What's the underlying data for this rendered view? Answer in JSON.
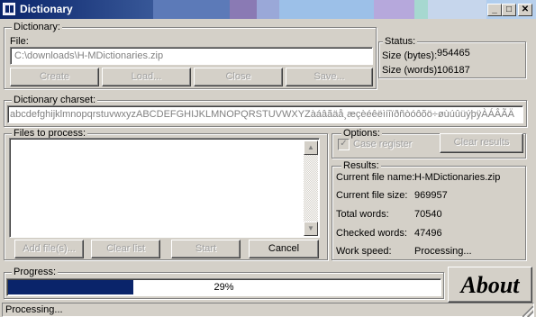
{
  "window": {
    "title": "Dictionary",
    "minimize_glyph": "_",
    "maximize_glyph": "□",
    "close_glyph": "✕"
  },
  "dictionary": {
    "group_label": "Dictionary:",
    "file_label": "File:",
    "file_path": "C:\\downloads\\H-MDictionaries.zip",
    "buttons": {
      "create": "Create",
      "load": "Load...",
      "close": "Close",
      "save": "Save..."
    }
  },
  "status": {
    "group_label": "Status:",
    "size_bytes_label": "Size (bytes):",
    "size_bytes_value": "954465",
    "size_words_label": "Size (words):",
    "size_words_value": "106187"
  },
  "charset": {
    "group_label": "Dictionary charset:",
    "value": "abcdefghijklmnopqrstuvwxyzABCDEFGHIJKLMNOPQRSTUVWXYZàáâãäå¸æçèéêëìíîïðñòóôõö÷øùúûüýþÿÀÁÂÃÄ"
  },
  "files": {
    "group_label": "Files to process:",
    "buttons": {
      "add": "Add file(s)...",
      "clear": "Clear list",
      "start": "Start",
      "cancel": "Cancel"
    }
  },
  "options": {
    "group_label": "Options:",
    "case_register_label": "Case register",
    "case_register_checked": true,
    "clear_results_label": "Clear results"
  },
  "results": {
    "group_label": "Results:",
    "current_file_name_label": "Current file name:",
    "current_file_name_value": "H-MDictionaries.zip",
    "current_file_size_label": "Current file size:",
    "current_file_size_value": "969957",
    "total_words_label": "Total words:",
    "total_words_value": "70540",
    "checked_words_label": "Checked words:",
    "checked_words_value": "47496",
    "work_speed_label": "Work speed:",
    "work_speed_value": "Processing..."
  },
  "progress": {
    "group_label": "Progress:",
    "percent_text": "29%",
    "fraction": 0.29
  },
  "about_label": "About",
  "statusbar_text": "Processing...",
  "colors": {
    "title_bar": "#0a246a",
    "face": "#d4d0c8",
    "progress_fill": "#0a246a"
  }
}
